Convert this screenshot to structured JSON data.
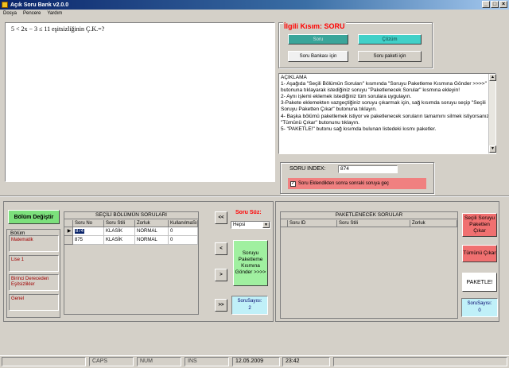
{
  "window": {
    "title": "Açık Soru Bank v2.0.0",
    "min_label": "_",
    "max_label": "□",
    "close_label": "×"
  },
  "menu": [
    "Dosya",
    "Pencere",
    "Yardım"
  ],
  "question": {
    "text": "5 < 2x − 3 ≤ 11   eşitsizliğinin Ç.K.=?"
  },
  "ilgili": {
    "title": "İlgili Kısım: SORU",
    "soru_label": "Soru",
    "cozum_label": "Çözüm",
    "bankasi_label": "Soru Bankası için",
    "paketi_label": "Soru paketi için"
  },
  "aciklama": {
    "text": "AÇIKLAMA\n1- Aşağıda \"Seçili Bölümün Soruları\" kısmında \"Soruyu Paketleme Kısmına Gönder >>>>\" butonuna tıklayarak istediğiniz soruyu \"Paketlenecek Sorular\" kısmına ekleyin!\n2- Aynı işlemi eklemek istediğiniz tüm sorulara uygulayın.\n3-Pakete eklemekten vazgeçtiğiniz soruyu çıkarmak için, sağ kısımda soruyu seçip \"Seçili Soruyu Paketten Çıkar\" butonuna tıklayın.\n4- Başka bölümü paketlemek istiyor ve paketlenecek soruların tamamını silmek istiyorsanız, \"Tümünü Çıkar\" butonunu tıklayın.\n5- \"PAKETLE!\" butonu sağ kısımda bulunan listedeki kısmı paketler."
  },
  "index": {
    "label": "SORU INDEX:",
    "value": "874",
    "checkbox_label": "Soru Eklendikten sonra sonraki soruya geç",
    "checked_mark": "✓"
  },
  "bolum": {
    "button": "Bölüm Değiştir",
    "group_label": "Bölüm",
    "items": [
      "Matematik",
      "Lise 1",
      "Birinci Dereceden Eşitsizlikler",
      "Genel"
    ]
  },
  "secili_table": {
    "caption": "SEÇİLİ BÖLÜMÜN SORULARI",
    "columns": [
      "Soru No",
      "Soru Stili",
      "Zorluk",
      "KullanılmaSı"
    ],
    "rows": [
      {
        "indicator": "▶",
        "cells": [
          "874",
          "KLASİK",
          "NORMAL",
          "0"
        ]
      },
      {
        "indicator": "",
        "cells": [
          "875",
          "KLASİK",
          "NORMAL",
          "0"
        ]
      }
    ]
  },
  "nav": {
    "first": "<<",
    "prev": "<",
    "next": ">",
    "last": ">>"
  },
  "filter": {
    "label": "Soru Süz:",
    "value": "Hepsi",
    "arrow": "▼"
  },
  "gonder": {
    "label": "Soruyu Paketleme Kısmına Gönder >>>>"
  },
  "left_count": {
    "label": "SoruSayısı:",
    "value": "2"
  },
  "paket_table": {
    "caption": "PAKETLENECEK SORULAR",
    "columns": [
      "Soru ID",
      "Soru Stili",
      "Zorluk"
    ]
  },
  "right_buttons": {
    "remove_selected": "Seçili Soruyu Paketten Çıkar",
    "remove_all": "Tümünü Çıkar",
    "paketle": "PAKETLE!"
  },
  "right_count": {
    "label": "SoruSayısı:",
    "value": "0"
  },
  "status": {
    "caps": "CAPS",
    "num": "NUM",
    "ins": "INS",
    "date": "12.05.2009",
    "time": "23:42"
  },
  "scroll": {
    "up": "▲",
    "down": "▼"
  }
}
